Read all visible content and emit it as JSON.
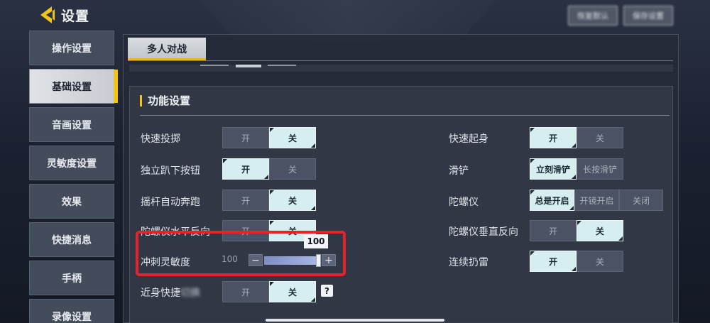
{
  "header": {
    "title": "设置",
    "top_buttons": [
      "恢复默认",
      "保存设置"
    ]
  },
  "sidebar": {
    "items": [
      {
        "label": "操作设置",
        "active": false
      },
      {
        "label": "基础设置",
        "active": true
      },
      {
        "label": "音画设置",
        "active": false
      },
      {
        "label": "灵敏度设置",
        "active": false
      },
      {
        "label": "效果",
        "active": false
      },
      {
        "label": "快捷消息",
        "active": false
      },
      {
        "label": "手柄",
        "active": false
      },
      {
        "label": "录像设置",
        "active": false
      }
    ]
  },
  "tabs": [
    {
      "label": "多人对战"
    }
  ],
  "section": {
    "title": "功能设置"
  },
  "left_settings": [
    {
      "label": "快速投掷",
      "options": [
        "开",
        "关"
      ],
      "selected": 1
    },
    {
      "label": "独立趴下按钮",
      "options": [
        "开",
        "关"
      ],
      "selected": 0
    },
    {
      "label": "摇杆自动奔跑",
      "options": [
        "开",
        "关"
      ],
      "selected": 1
    },
    {
      "label": "陀螺仪水平反向",
      "options": [
        "开",
        "关"
      ],
      "selected": 1
    },
    {
      "label": "近身快捷",
      "options": [
        "开",
        "关"
      ],
      "selected": 1
    }
  ],
  "slider": {
    "label": "冲刺灵敏度",
    "value_text": "100",
    "tooltip": "100",
    "minus": "−",
    "plus": "+",
    "fraction": 1.0
  },
  "right_settings": [
    {
      "label": "快速起身",
      "options": [
        "开",
        "关"
      ],
      "selected": 0
    },
    {
      "label": "滑铲",
      "options": [
        "立刻滑铲",
        "长按滑铲"
      ],
      "selected": 0
    },
    {
      "label": "陀螺仪",
      "options": [
        "总是开启",
        "开镜开启",
        "关闭"
      ],
      "selected": 0
    },
    {
      "label": "陀螺仪垂直反向",
      "options": [
        "开",
        "关"
      ],
      "selected": 1
    },
    {
      "label": "连续扔雷",
      "options": [
        "开",
        "关"
      ],
      "selected": 0
    }
  ],
  "help": {
    "symbol": "?"
  },
  "colors": {
    "accent": "#f0c419",
    "highlight_box": "#e4232a",
    "toggle_on": "#d7eef0"
  }
}
